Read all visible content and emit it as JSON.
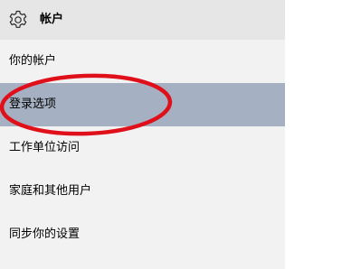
{
  "header": {
    "title": "帐户",
    "icon": "gear-icon"
  },
  "sidebar": {
    "items": [
      {
        "label": "你的帐户",
        "selected": false
      },
      {
        "label": "登录选项",
        "selected": true
      },
      {
        "label": "工作单位访问",
        "selected": false
      },
      {
        "label": "家庭和其他用户",
        "selected": false
      },
      {
        "label": "同步你的设置",
        "selected": false
      }
    ]
  },
  "colors": {
    "pane_background": "#f2f2f2",
    "header_background": "#e6e6e6",
    "selected_background": "#a5b1c2",
    "annotation_ellipse": "#e0101a"
  }
}
